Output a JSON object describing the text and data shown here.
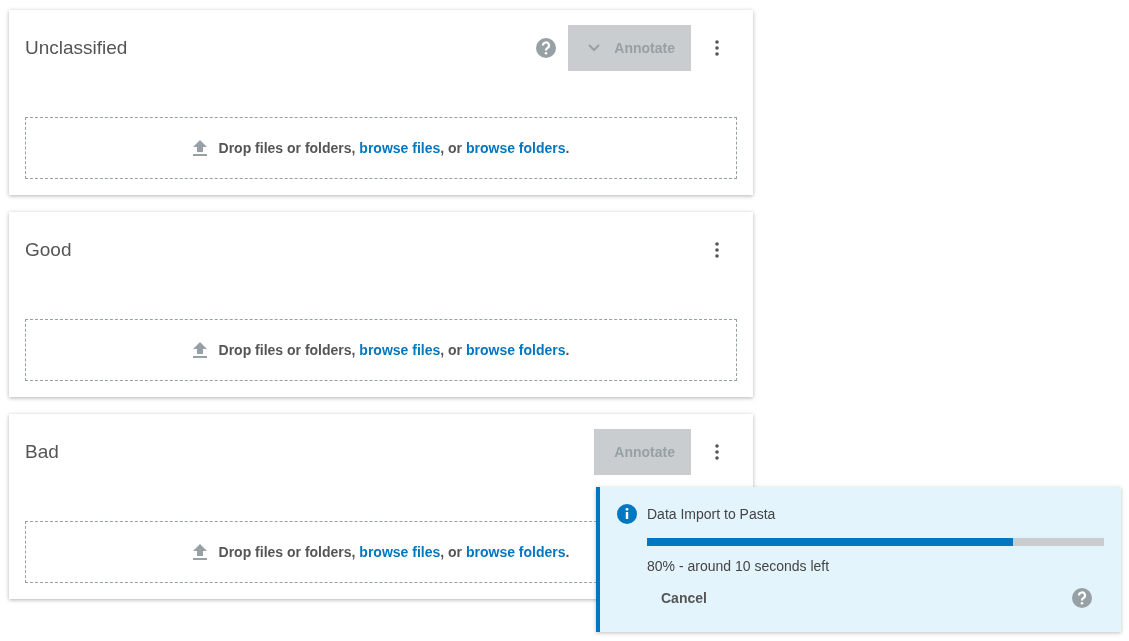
{
  "cards": [
    {
      "title": "Unclassified",
      "help": true,
      "annotate": {
        "label": "Annotate",
        "dropdown": true,
        "disabled": true
      },
      "drop": {
        "prefix": "Drop files or folders,",
        "link_1": "browse files",
        "middle": ", or",
        "link_2": "browse folders",
        "suffix": "."
      }
    },
    {
      "title": "Good",
      "help": false,
      "drop": {
        "prefix": "Drop files or folders,",
        "link_1": "browse files",
        "middle": ", or",
        "link_2": "browse folders",
        "suffix": "."
      }
    },
    {
      "title": "Bad",
      "help": false,
      "annotate": {
        "label": "Annotate",
        "dropdown": false,
        "disabled": true
      },
      "drop": {
        "prefix": "Drop files or folders,",
        "link_1": "browse files",
        "middle": ", or",
        "link_2": "browse folders",
        "suffix": "."
      }
    }
  ],
  "toast": {
    "title": "Data Import to Pasta",
    "level": 0.8,
    "status": "80% - around 10 seconds left",
    "cancel": "Cancel"
  }
}
